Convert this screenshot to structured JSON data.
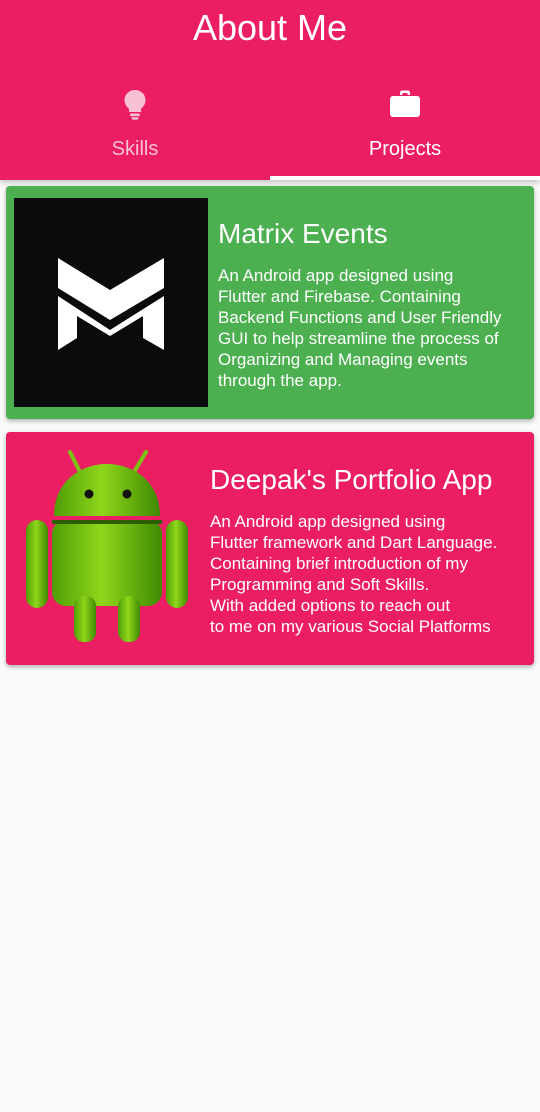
{
  "app": {
    "title": "About Me",
    "accent": "#ec1e63"
  },
  "tabs": [
    {
      "label": "Skills",
      "icon": "lightbulb-icon",
      "selected": false
    },
    {
      "label": "Projects",
      "icon": "briefcase-icon",
      "selected": true
    }
  ],
  "projects": [
    {
      "title": "Matrix Events",
      "description": "An Android app designed using\nFlutter and Firebase. Containing\nBackend Functions and User Friendly\nGUI to help streamline the process of\nOrganizing and Managing events\nthrough the app.",
      "background": "#4caf50",
      "image": "matrix-events-logo"
    },
    {
      "title": "Deepak's Portfolio App",
      "description": "An Android app designed using\nFlutter framework and Dart Language.\nContaining brief introduction of my\nProgramming and Soft Skills.\nWith added options to reach out\nto me on my various Social Platforms",
      "background": "#ec1e63",
      "image": "android-robot-image"
    }
  ]
}
